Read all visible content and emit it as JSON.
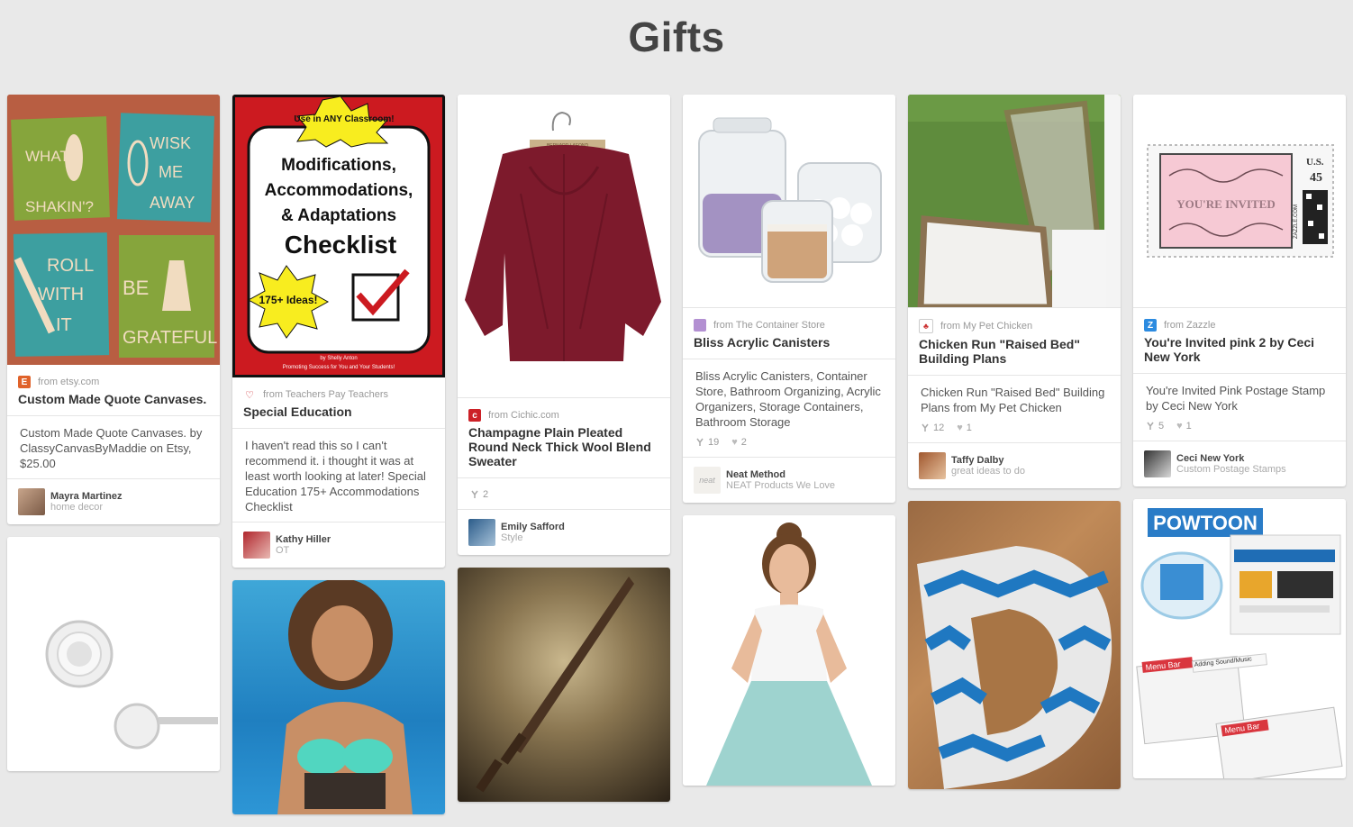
{
  "board": {
    "title": "Gifts"
  },
  "pins": {
    "p1": {
      "source": "from etsy.com",
      "title": "Custom Made Quote Canvases.",
      "desc": "Custom Made Quote Canvases. by ClassyCanvasByMaddie on Etsy, $25.00",
      "pinner": "Mayra Martinez",
      "board": "home decor",
      "canvas": [
        "WHAT'S SHAKIN'?",
        "WISK ME AWAY",
        "ROLL WITH IT",
        "BE GRATEFUL"
      ]
    },
    "p2": {
      "source": "from Teachers Pay Teachers",
      "title": "Special Education",
      "desc": "I haven't read this so I can't recommend it. i thought it was at least worth looking at later! Special Education 175+ Accommodations Checklist",
      "pinner": "Kathy Hiller",
      "board": "OT",
      "poster": {
        "badge": "Use in ANY Classroom!",
        "line1": "Modifications,",
        "line2": "Accommodations,",
        "line3": "& Adaptations",
        "line4": "Checklist",
        "burst": "175+ Ideas!",
        "author": "by Shelly Anton",
        "tagline": "Promoting Success for You and Your Students!"
      }
    },
    "p3": {
      "source": "from Cichic.com",
      "title": "Champagne Plain Pleated Round Neck Thick Wool Blend Sweater",
      "repins": "2",
      "pinner": "Emily Safford",
      "board": "Style",
      "hanger_label": "BERNARD LAFOND"
    },
    "p4": {
      "source": "from The Container Store",
      "title": "Bliss Acrylic Canisters",
      "desc": "Bliss Acrylic Canisters, Container Store, Bathroom Organizing, Acrylic Organizers, Storage Containers, Bathroom Storage",
      "repins": "19",
      "likes": "2",
      "pinner": "Neat Method",
      "board": "NEAT Products We Love",
      "avatar_text": "neat"
    },
    "p5": {
      "source": "from My Pet Chicken",
      "title": "Chicken Run \"Raised Bed\" Building Plans",
      "desc": "Chicken Run \"Raised Bed\" Building Plans from My Pet Chicken",
      "repins": "12",
      "likes": "1",
      "pinner": "Taffy Dalby",
      "board": "great ideas to do"
    },
    "p6": {
      "source": "from Zazzle",
      "title": "You're Invited pink 2 by Ceci New York",
      "desc": "You're Invited Pink Postage Stamp by Ceci New York",
      "repins": "5",
      "likes": "1",
      "pinner": "Ceci New York",
      "board": "Custom Postage Stamps",
      "stamp": {
        "text": "YOU'RE INVITED",
        "country": "U.S.",
        "value": "45",
        "brand": "ZAZZLE.COM"
      }
    },
    "p12": {
      "logo": "POWTOON",
      "menu1": "Menu Bar",
      "menu2": "Menu Bar",
      "sub": "Adding Sound/Music"
    }
  },
  "colors": {
    "background": "#e9e9e9",
    "etsy": "#e0622a",
    "pinterest_red": "#cc2127",
    "zazzle": "#2c8be0"
  }
}
